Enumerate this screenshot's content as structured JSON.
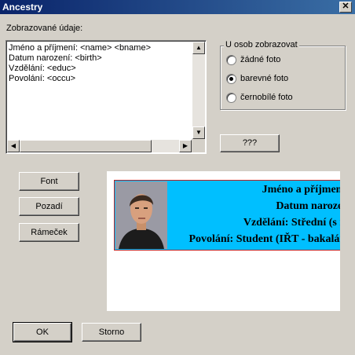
{
  "window": {
    "title": "Ancestry",
    "close_label": "✕"
  },
  "fields": {
    "label": "Zobrazované údaje:",
    "lines": [
      "Jméno a příjmení: <name> <bname>",
      "Datum narození: <birth>",
      "Vzdělání: <educ>",
      "Povolání: <occu>"
    ]
  },
  "photo_group": {
    "title": "U osob zobrazovat",
    "options": [
      {
        "label": "žádné foto",
        "selected": false
      },
      {
        "label": "barevné foto",
        "selected": true
      },
      {
        "label": "černobílé foto",
        "selected": false
      }
    ]
  },
  "buttons": {
    "more": "???",
    "font": "Font",
    "background": "Pozadí",
    "frame": "Rámeček",
    "ok": "OK",
    "cancel": "Storno"
  },
  "preview": {
    "lines": [
      "Jméno a příjmení: ",
      "Datum narozen",
      "Vzdělání: Střední (s m",
      "Povolání: Student (IŘT - bakalářs"
    ]
  },
  "colors": {
    "card_background": "#00bfff",
    "card_border": "#c02020"
  },
  "icons": [
    "close-icon",
    "scroll-up-icon",
    "scroll-down-icon",
    "scroll-left-icon",
    "scroll-right-icon"
  ]
}
